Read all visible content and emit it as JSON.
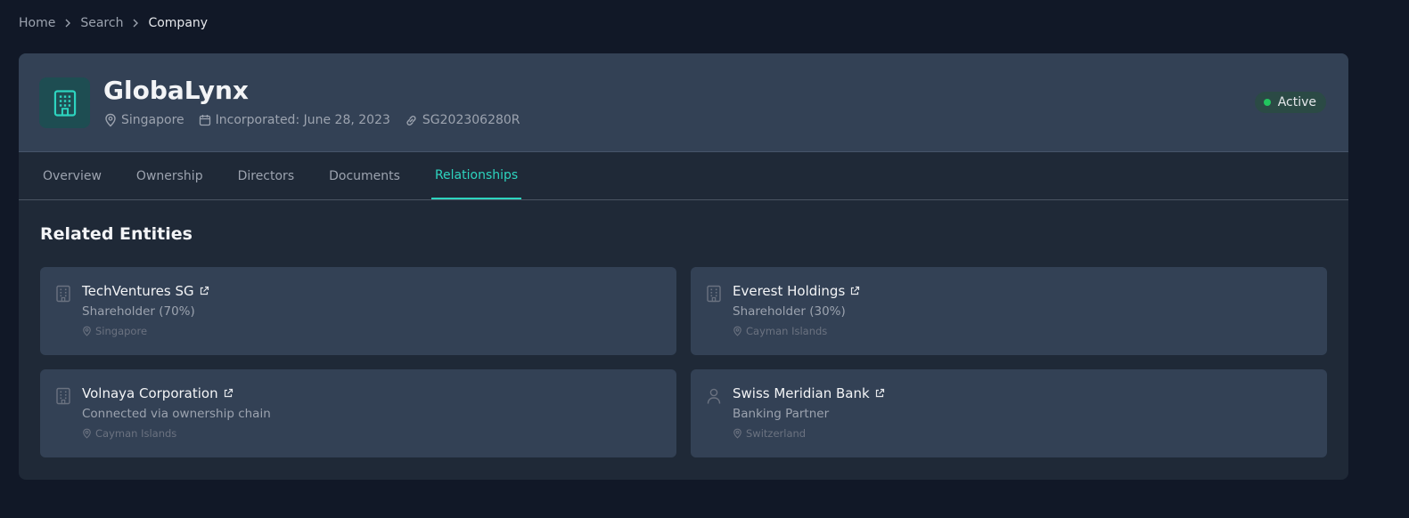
{
  "breadcrumb": [
    "Home",
    "Search",
    "Company"
  ],
  "company": {
    "name": "GlobaLynx",
    "location": "Singapore",
    "incorporated": "Incorporated: June 28, 2023",
    "registration": "SG202306280R",
    "status": "Active"
  },
  "tabs": [
    "Overview",
    "Ownership",
    "Directors",
    "Documents",
    "Relationships"
  ],
  "active_tab": "Relationships",
  "section_title": "Related Entities",
  "entities": [
    {
      "name": "TechVentures SG",
      "role": "Shareholder (70%)",
      "location": "Singapore",
      "icon": "building-icon"
    },
    {
      "name": "Everest Holdings",
      "role": "Shareholder (30%)",
      "location": "Cayman Islands",
      "icon": "building-icon"
    },
    {
      "name": "Volnaya Corporation",
      "role": "Connected via ownership chain",
      "location": "Cayman Islands",
      "icon": "building-icon"
    },
    {
      "name": "Swiss Meridian Bank",
      "role": "Banking Partner",
      "location": "Switzerland",
      "icon": "person-icon"
    }
  ],
  "colors": {
    "background": "#111827",
    "panel": "#1f2937",
    "card": "#334155",
    "accent": "#2dd4bf",
    "status": "#22c55e"
  }
}
